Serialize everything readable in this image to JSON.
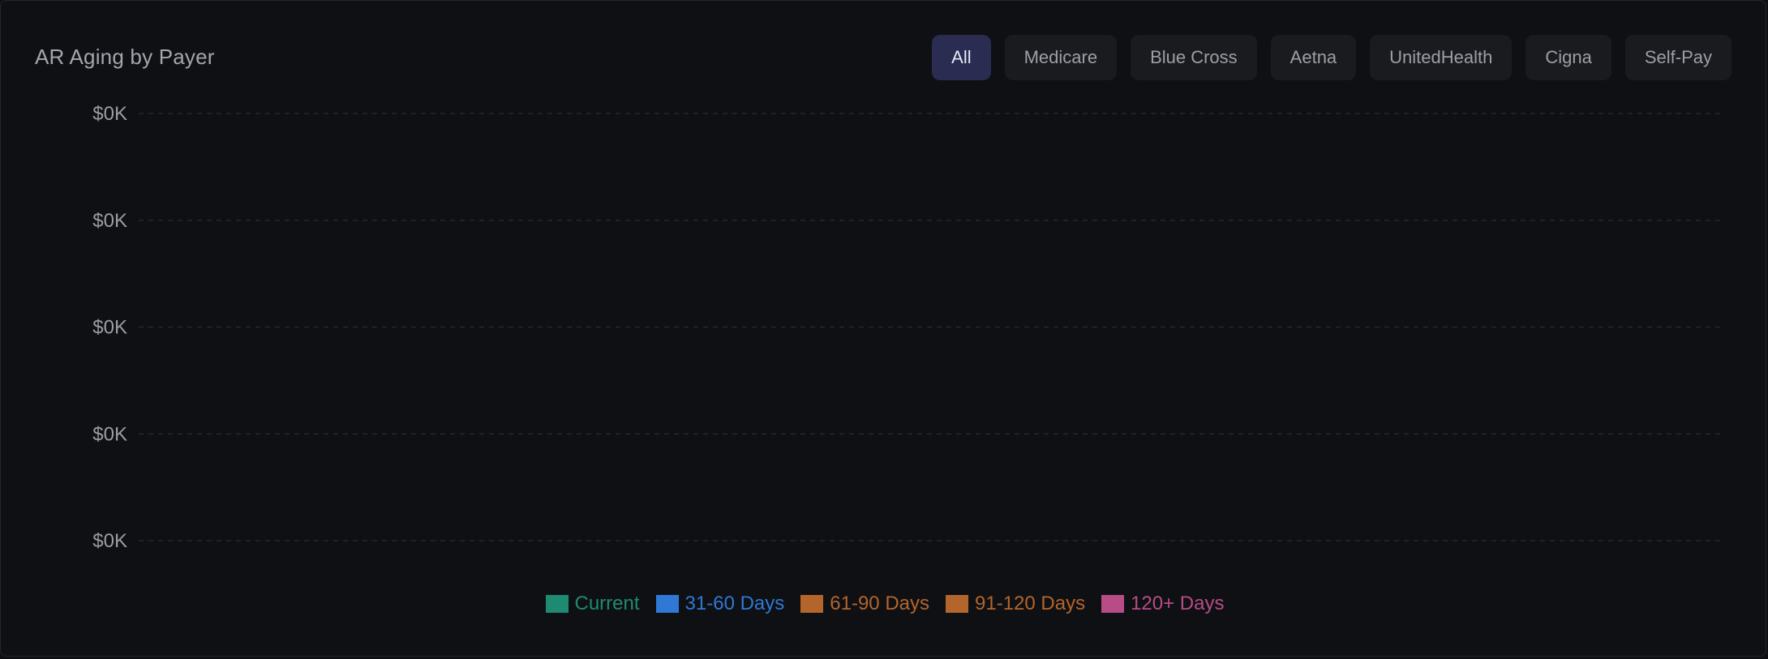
{
  "title": "AR Aging by Payer",
  "filters": {
    "active": "All",
    "items": [
      "All",
      "Medicare",
      "Blue Cross",
      "Aetna",
      "UnitedHealth",
      "Cigna",
      "Self-Pay"
    ]
  },
  "colors": {
    "current": "#1e8a72",
    "d31_60": "#2f78d6",
    "d61_90": "#b4652b",
    "d91_120": "#b4652b",
    "d120_plus": "#b74c86"
  },
  "chart_data": {
    "type": "bar",
    "title": "AR Aging by Payer",
    "categories": [],
    "series": [
      {
        "name": "Current",
        "values": []
      },
      {
        "name": "31-60 Days",
        "values": []
      },
      {
        "name": "61-90 Days",
        "values": []
      },
      {
        "name": "91-120 Days",
        "values": []
      },
      {
        "name": "120+ Days",
        "values": []
      }
    ],
    "ylim": [
      0,
      0
    ],
    "y_ticks": [
      "$0K",
      "$0K",
      "$0K",
      "$0K",
      "$0K"
    ],
    "grid": true,
    "legend_position": "bottom"
  },
  "legend": [
    {
      "label": "Current",
      "color": "#1e8a72"
    },
    {
      "label": "31-60 Days",
      "color": "#2f78d6"
    },
    {
      "label": "61-90 Days",
      "color": "#b4652b"
    },
    {
      "label": "91-120 Days",
      "color": "#b4652b"
    },
    {
      "label": "120+ Days",
      "color": "#b74c86"
    }
  ]
}
